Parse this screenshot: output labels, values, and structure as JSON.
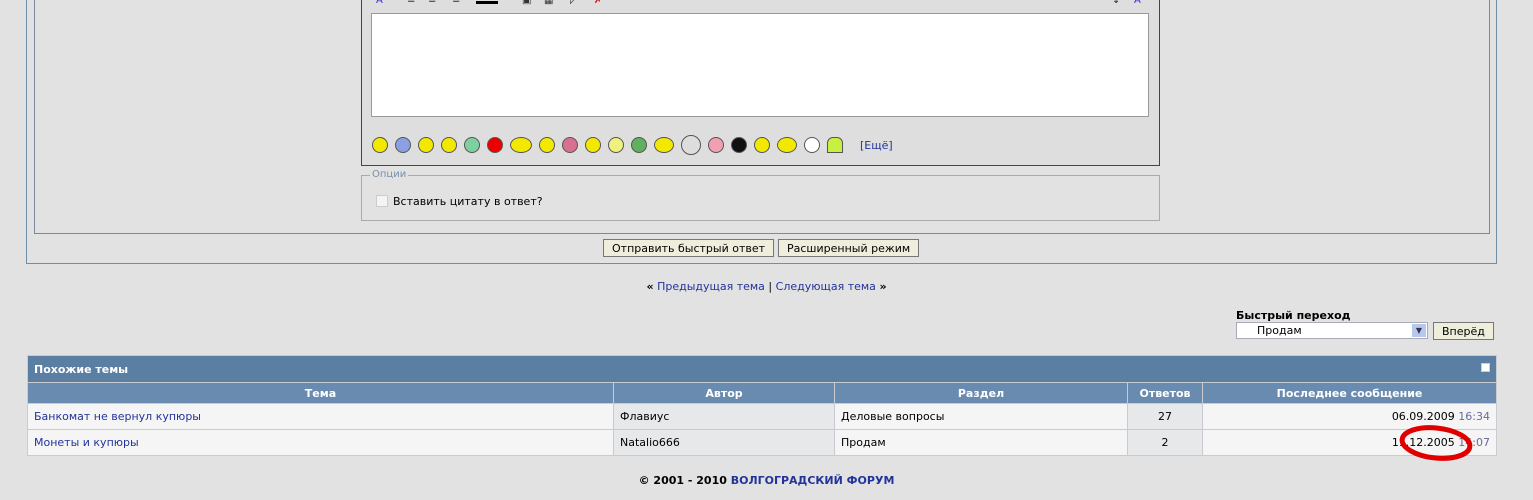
{
  "editor": {
    "more_smilies": "[Ещё]",
    "smilies": [
      "smile",
      "sad",
      "happy",
      "wink",
      "grin",
      "angry",
      "writing",
      "cool",
      "mad",
      "neutral",
      "confused",
      "sick",
      "music",
      "hide",
      "pig",
      "spider",
      "ok",
      "smoke",
      "cowboy",
      "ghost"
    ]
  },
  "options": {
    "legend": "Опции",
    "quote_label": "Вставить цитату в ответ?",
    "quote_checked": false
  },
  "buttons": {
    "quick_reply": "Отправить быстрый ответ",
    "advanced": "Расширенный режим"
  },
  "nav": {
    "prev_arrows": "«",
    "prev": "Предыдущая тема",
    "sep": "|",
    "next": "Следующая тема",
    "next_arrows": "»"
  },
  "quickjump": {
    "label": "Быстрый переход",
    "selected": "Продам",
    "go": "Вперёд"
  },
  "similar": {
    "title": "Похожие темы",
    "columns": [
      "Тема",
      "Автор",
      "Раздел",
      "Ответов",
      "Последнее сообщение"
    ],
    "rows": [
      {
        "topic": "Банкомат не вернул купюры",
        "author": "Флавиус",
        "section": "Деловые вопросы",
        "replies": "27",
        "date": "06.09.2009",
        "time": "16:34"
      },
      {
        "topic": "Монеты и купюры",
        "author": "Natalio666",
        "section": "Продам",
        "replies": "2",
        "date": "11.12.2005",
        "time": "14:07"
      }
    ]
  },
  "footer": {
    "copyright": "© 2001 - 2010",
    "site": "ВОЛГОГРАДСКИЙ ФОРУМ"
  },
  "colors": {
    "header": "#5b7fa3",
    "link": "#223399",
    "annotation": "#e00000"
  }
}
